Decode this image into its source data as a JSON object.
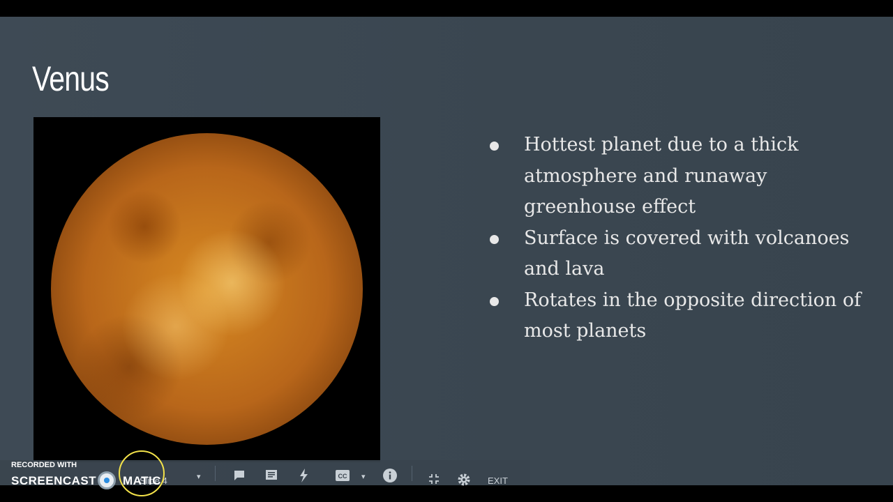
{
  "slide": {
    "title": "Venus",
    "image_alt": "Venus surface radar image",
    "bullets": [
      "Hottest planet due to a thick atmosphere and runaway greenhouse effect",
      "Surface is covered with volcanoes and lava",
      "Rotates in the opposite direction of most planets"
    ]
  },
  "toolbar": {
    "slide_selector_label": "Slide 4",
    "exit_label": "EXIT",
    "icons": [
      "chevron-down-icon",
      "comment-icon",
      "speaker-notes-icon",
      "laser-pointer-icon",
      "captions-icon",
      "info-icon",
      "exit-fullscreen-icon",
      "gear-icon"
    ]
  },
  "watermark": {
    "top_text": "RECORDED WITH",
    "brand_left": "SCREENCAST",
    "brand_right": "MATIC"
  },
  "colors": {
    "slide_background": "#3e4a55",
    "bullet_text": "#e8e8e8",
    "cursor_ring": "#f3e24a"
  }
}
